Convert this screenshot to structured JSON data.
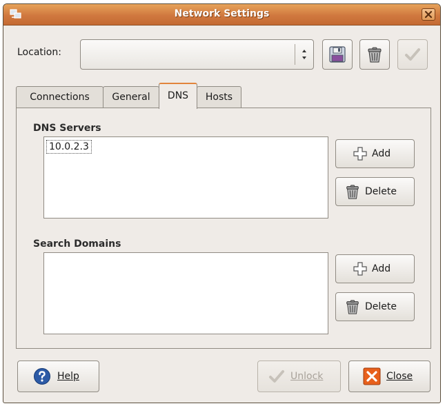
{
  "window": {
    "title": "Network Settings"
  },
  "location": {
    "label": "Location:",
    "value": ""
  },
  "tabs": [
    {
      "label": "Connections"
    },
    {
      "label": "General"
    },
    {
      "label": "DNS"
    },
    {
      "label": "Hosts"
    }
  ],
  "active_tab": "DNS",
  "dns": {
    "servers_label": "DNS Servers",
    "servers": [
      "10.0.2.3"
    ],
    "add_label": "Add",
    "delete_label": "Delete",
    "domains_label": "Search Domains",
    "domains": [],
    "domains_add_label": "Add",
    "domains_delete_label": "Delete"
  },
  "footer": {
    "help_label": "Help",
    "unlock_label": "Unlock",
    "close_label": "Close"
  },
  "colors": {
    "titlebar": "#d0783f",
    "active_tab_accent": "#e2843b",
    "help_blue": "#2c5aa6",
    "close_orange": "#e8601c"
  }
}
